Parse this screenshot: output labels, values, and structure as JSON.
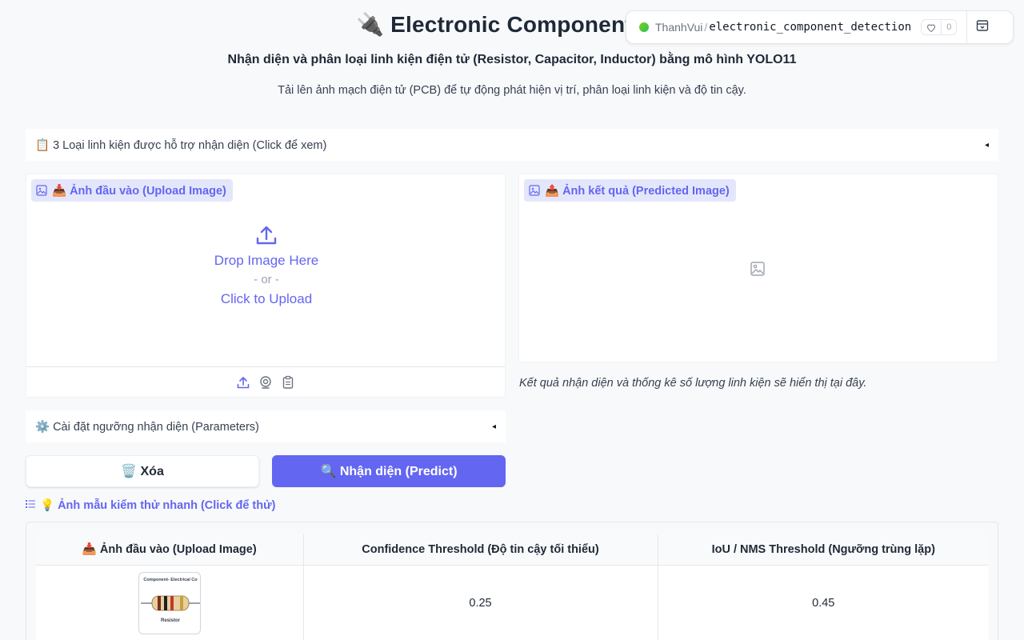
{
  "header": {
    "title_icon": "🔌",
    "title": "Electronic Component De",
    "subtitle": "Nhận diện và phân loại linh kiện điện tử (Resistor, Capacitor, Inductor) bằng mô hình YOLO11",
    "description": "Tải lên ảnh mạch điện tử (PCB) để tự động phát hiện vị trí, phân loại linh kiện và độ tin cậy."
  },
  "hf_badge": {
    "user": "ThanhVui",
    "separator": "/",
    "repo": "electronic_component_detection",
    "likes": "0"
  },
  "supported_accordion": {
    "label": "📋 3 Loại linh kiện được hỗ trợ nhận diện (Click để xem)",
    "arrow": "◂"
  },
  "input_panel": {
    "label": "📥 Ảnh đầu vào (Upload Image)",
    "drop_text": "Drop Image Here",
    "or_text": "- or -",
    "click_text": "Click to Upload"
  },
  "output_panel": {
    "label": "📤 Ảnh kết quả (Predicted Image)",
    "caption": "Kết quả nhận diện và thống kê số lượng linh kiện sẽ hiển thị tại đây."
  },
  "params_accordion": {
    "label": "⚙️ Cài đặt ngưỡng nhận diện (Parameters)",
    "arrow": "◂"
  },
  "buttons": {
    "clear": "🗑️ Xóa",
    "predict": "🔍 Nhận diện (Predict)"
  },
  "examples": {
    "label": "💡 Ảnh mẫu kiểm thử nhanh (Click để thử)",
    "headers": [
      "📥 Ảnh đầu vào (Upload Image)",
      "Confidence Threshold (Độ tin cậy tối thiểu)",
      "IoU / NMS Threshold (Ngưỡng trùng lặp)"
    ],
    "rows": [
      {
        "thumb_top_text": "Component- Electrical Co",
        "thumb_bottom_text": "Resistor",
        "confidence": "0.25",
        "iou": "0.45"
      }
    ]
  }
}
